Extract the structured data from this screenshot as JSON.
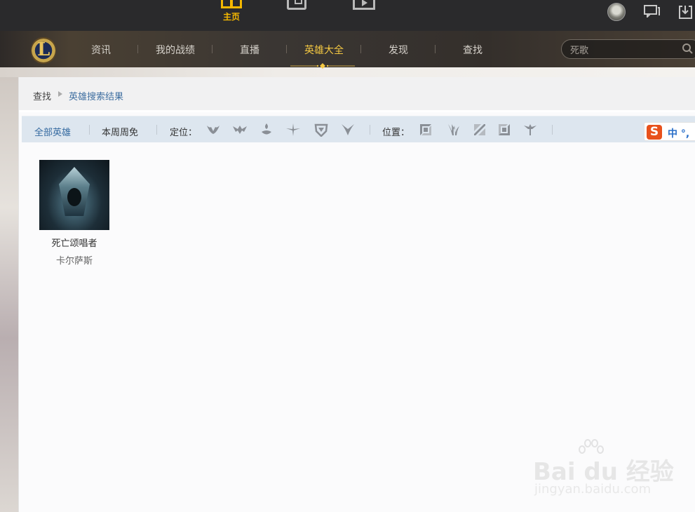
{
  "topbar": {
    "home_label": "主页",
    "icons": [
      "home-icon",
      "shop-icon",
      "video-icon",
      "avatar",
      "message-icon",
      "download-icon"
    ]
  },
  "nav": {
    "items": [
      {
        "label": "资讯"
      },
      {
        "label": "我的战绩"
      },
      {
        "label": "直播"
      },
      {
        "label": "英雄大全",
        "active": true
      },
      {
        "label": "发现"
      },
      {
        "label": "查找"
      }
    ],
    "search_value": "死歌",
    "accent_color": "#f4c842"
  },
  "breadcrumb": {
    "home": "查找",
    "current": "英雄搜索结果"
  },
  "filter": {
    "all_heroes": "全部英雄",
    "weekly_free": "本周周免",
    "role_label": "定位：",
    "position_label": "位置：",
    "role_icons": [
      "assassin-icon",
      "fighter-icon",
      "mage-icon",
      "marksman-icon",
      "tank-icon",
      "support-icon"
    ],
    "position_icons": [
      "top-lane-icon",
      "jungle-icon",
      "mid-lane-icon",
      "bot-lane-icon",
      "support-lane-icon"
    ]
  },
  "ime": {
    "logo": "S",
    "text": "中 °,"
  },
  "results": [
    {
      "title": "死亡颂唱者",
      "name": "卡尔萨斯"
    }
  ],
  "watermark": {
    "text": "Bai du 经验",
    "sub": "jingyan.baidu.com"
  }
}
